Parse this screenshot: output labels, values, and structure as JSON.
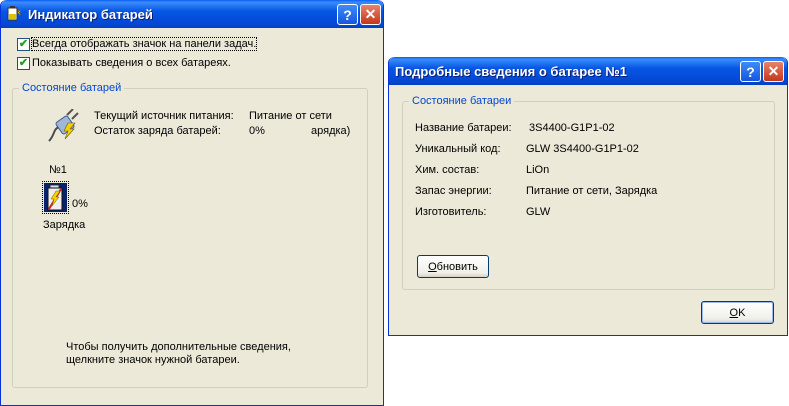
{
  "left_window": {
    "title": "Индикатор батарей",
    "help_glyph": "?",
    "close_glyph": "✕",
    "checkbox_always_show": {
      "label": "Всегда отображать значок на панели задач.",
      "checked": true
    },
    "checkbox_show_all": {
      "label": "Показывать сведения о всех батареях.",
      "checked": true
    },
    "checkmark_glyph": "✔",
    "battery_status_group": {
      "legend": "Состояние батарей",
      "power_source_label": "Текущий источник питания:",
      "power_source_value": "Питание от сети",
      "charge_label": "Остаток заряда батарей:",
      "charge_value": "0%",
      "charge_value_suffix": "арядка)",
      "battery_number": "№1",
      "battery_percent": "0%",
      "battery_state": "Зарядка",
      "hint_line1": "Чтобы получить дополнительные сведения,",
      "hint_line2": "щелкните значок нужной батареи."
    }
  },
  "right_window": {
    "title": "Подробные сведения о батарее №1",
    "help_glyph": "?",
    "close_glyph": "✕",
    "group_legend": "Состояние батареи",
    "details": [
      {
        "label": "Название батареи:",
        "value": "3S4400-G1P1-02"
      },
      {
        "label": "Уникальный код:",
        "value": "GLW 3S4400-G1P1-02"
      },
      {
        "label": "Хим. состав:",
        "value": "LiOn"
      },
      {
        "label": "Запас энергии:",
        "value": "Питание от сети, Зарядка"
      },
      {
        "label": "Изготовитель:",
        "value": "GLW"
      }
    ],
    "refresh_button": "Обновить",
    "ok_button": "OK"
  },
  "colors": {
    "titlebar": "#0554e3",
    "dialog_bg": "#ece9d8",
    "group_legend": "#0046d5",
    "checkmark": "#21a121",
    "close_button": "#c5361a"
  }
}
